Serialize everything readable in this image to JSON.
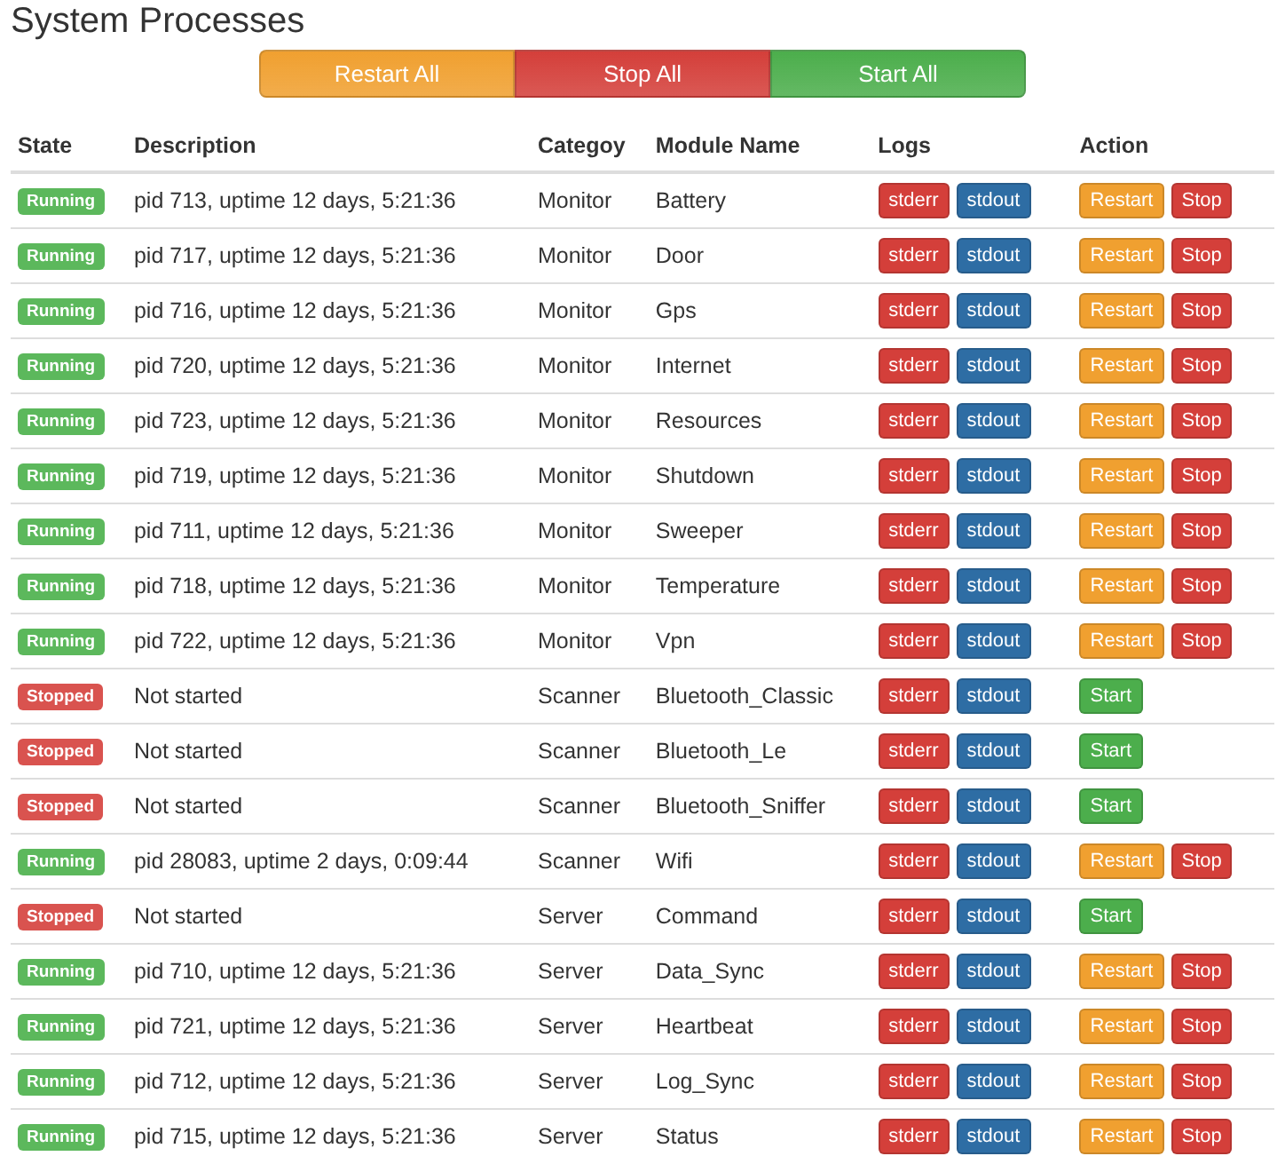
{
  "title": "System Processes",
  "bulk_actions": [
    {
      "label": "Restart All",
      "kind": "warning"
    },
    {
      "label": "Stop All",
      "kind": "danger"
    },
    {
      "label": "Start All",
      "kind": "success"
    }
  ],
  "table": {
    "columns": [
      "State",
      "Description",
      "Categoy",
      "Module Name",
      "Logs",
      "Action"
    ],
    "rows": [
      {
        "state": {
          "label": "Running",
          "kind": "running"
        },
        "description": "pid 713, uptime 12 days, 5:21:36",
        "category": "Monitor",
        "module": "Battery",
        "logs": [
          "stderr",
          "stdout"
        ],
        "actions": [
          {
            "label": "Restart",
            "kind": "warning"
          },
          {
            "label": "Stop",
            "kind": "danger"
          }
        ]
      },
      {
        "state": {
          "label": "Running",
          "kind": "running"
        },
        "description": "pid 717, uptime 12 days, 5:21:36",
        "category": "Monitor",
        "module": "Door",
        "logs": [
          "stderr",
          "stdout"
        ],
        "actions": [
          {
            "label": "Restart",
            "kind": "warning"
          },
          {
            "label": "Stop",
            "kind": "danger"
          }
        ]
      },
      {
        "state": {
          "label": "Running",
          "kind": "running"
        },
        "description": "pid 716, uptime 12 days, 5:21:36",
        "category": "Monitor",
        "module": "Gps",
        "logs": [
          "stderr",
          "stdout"
        ],
        "actions": [
          {
            "label": "Restart",
            "kind": "warning"
          },
          {
            "label": "Stop",
            "kind": "danger"
          }
        ]
      },
      {
        "state": {
          "label": "Running",
          "kind": "running"
        },
        "description": "pid 720, uptime 12 days, 5:21:36",
        "category": "Monitor",
        "module": "Internet",
        "logs": [
          "stderr",
          "stdout"
        ],
        "actions": [
          {
            "label": "Restart",
            "kind": "warning"
          },
          {
            "label": "Stop",
            "kind": "danger"
          }
        ]
      },
      {
        "state": {
          "label": "Running",
          "kind": "running"
        },
        "description": "pid 723, uptime 12 days, 5:21:36",
        "category": "Monitor",
        "module": "Resources",
        "logs": [
          "stderr",
          "stdout"
        ],
        "actions": [
          {
            "label": "Restart",
            "kind": "warning"
          },
          {
            "label": "Stop",
            "kind": "danger"
          }
        ]
      },
      {
        "state": {
          "label": "Running",
          "kind": "running"
        },
        "description": "pid 719, uptime 12 days, 5:21:36",
        "category": "Monitor",
        "module": "Shutdown",
        "logs": [
          "stderr",
          "stdout"
        ],
        "actions": [
          {
            "label": "Restart",
            "kind": "warning"
          },
          {
            "label": "Stop",
            "kind": "danger"
          }
        ]
      },
      {
        "state": {
          "label": "Running",
          "kind": "running"
        },
        "description": "pid 711, uptime 12 days, 5:21:36",
        "category": "Monitor",
        "module": "Sweeper",
        "logs": [
          "stderr",
          "stdout"
        ],
        "actions": [
          {
            "label": "Restart",
            "kind": "warning"
          },
          {
            "label": "Stop",
            "kind": "danger"
          }
        ]
      },
      {
        "state": {
          "label": "Running",
          "kind": "running"
        },
        "description": "pid 718, uptime 12 days, 5:21:36",
        "category": "Monitor",
        "module": "Temperature",
        "logs": [
          "stderr",
          "stdout"
        ],
        "actions": [
          {
            "label": "Restart",
            "kind": "warning"
          },
          {
            "label": "Stop",
            "kind": "danger"
          }
        ]
      },
      {
        "state": {
          "label": "Running",
          "kind": "running"
        },
        "description": "pid 722, uptime 12 days, 5:21:36",
        "category": "Monitor",
        "module": "Vpn",
        "logs": [
          "stderr",
          "stdout"
        ],
        "actions": [
          {
            "label": "Restart",
            "kind": "warning"
          },
          {
            "label": "Stop",
            "kind": "danger"
          }
        ]
      },
      {
        "state": {
          "label": "Stopped",
          "kind": "stopped"
        },
        "description": "Not started",
        "category": "Scanner",
        "module": "Bluetooth_Classic",
        "logs": [
          "stderr",
          "stdout"
        ],
        "actions": [
          {
            "label": "Start",
            "kind": "success"
          }
        ]
      },
      {
        "state": {
          "label": "Stopped",
          "kind": "stopped"
        },
        "description": "Not started",
        "category": "Scanner",
        "module": "Bluetooth_Le",
        "logs": [
          "stderr",
          "stdout"
        ],
        "actions": [
          {
            "label": "Start",
            "kind": "success"
          }
        ]
      },
      {
        "state": {
          "label": "Stopped",
          "kind": "stopped"
        },
        "description": "Not started",
        "category": "Scanner",
        "module": "Bluetooth_Sniffer",
        "logs": [
          "stderr",
          "stdout"
        ],
        "actions": [
          {
            "label": "Start",
            "kind": "success"
          }
        ]
      },
      {
        "state": {
          "label": "Running",
          "kind": "running"
        },
        "description": "pid 28083, uptime 2 days, 0:09:44",
        "category": "Scanner",
        "module": "Wifi",
        "logs": [
          "stderr",
          "stdout"
        ],
        "actions": [
          {
            "label": "Restart",
            "kind": "warning"
          },
          {
            "label": "Stop",
            "kind": "danger"
          }
        ]
      },
      {
        "state": {
          "label": "Stopped",
          "kind": "stopped"
        },
        "description": "Not started",
        "category": "Server",
        "module": "Command",
        "logs": [
          "stderr",
          "stdout"
        ],
        "actions": [
          {
            "label": "Start",
            "kind": "success"
          }
        ]
      },
      {
        "state": {
          "label": "Running",
          "kind": "running"
        },
        "description": "pid 710, uptime 12 days, 5:21:36",
        "category": "Server",
        "module": "Data_Sync",
        "logs": [
          "stderr",
          "stdout"
        ],
        "actions": [
          {
            "label": "Restart",
            "kind": "warning"
          },
          {
            "label": "Stop",
            "kind": "danger"
          }
        ]
      },
      {
        "state": {
          "label": "Running",
          "kind": "running"
        },
        "description": "pid 721, uptime 12 days, 5:21:36",
        "category": "Server",
        "module": "Heartbeat",
        "logs": [
          "stderr",
          "stdout"
        ],
        "actions": [
          {
            "label": "Restart",
            "kind": "warning"
          },
          {
            "label": "Stop",
            "kind": "danger"
          }
        ]
      },
      {
        "state": {
          "label": "Running",
          "kind": "running"
        },
        "description": "pid 712, uptime 12 days, 5:21:36",
        "category": "Server",
        "module": "Log_Sync",
        "logs": [
          "stderr",
          "stdout"
        ],
        "actions": [
          {
            "label": "Restart",
            "kind": "warning"
          },
          {
            "label": "Stop",
            "kind": "danger"
          }
        ]
      },
      {
        "state": {
          "label": "Running",
          "kind": "running"
        },
        "description": "pid 715, uptime 12 days, 5:21:36",
        "category": "Server",
        "module": "Status",
        "logs": [
          "stderr",
          "stdout"
        ],
        "actions": [
          {
            "label": "Restart",
            "kind": "warning"
          },
          {
            "label": "Stop",
            "kind": "danger"
          }
        ]
      }
    ]
  }
}
